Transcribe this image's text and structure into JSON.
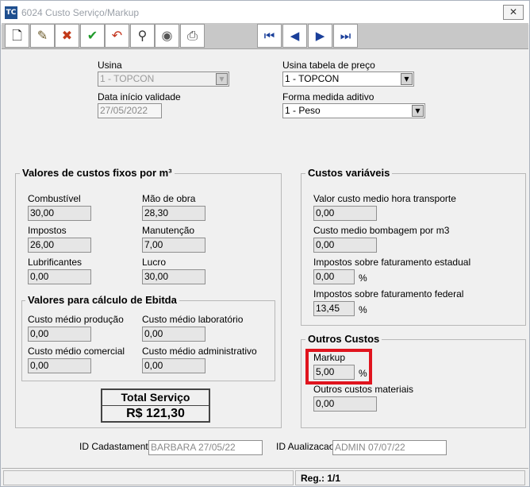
{
  "window": {
    "title": "6024 Custo Serviço/Markup",
    "app_icon": "app-logo-icon",
    "close_glyph": "✕"
  },
  "toolbar": {
    "buttons": [
      {
        "icon": "new-document-icon",
        "glyph": "🗋"
      },
      {
        "icon": "edit-pencil-icon",
        "glyph": "✎"
      },
      {
        "icon": "delete-eraser-icon",
        "glyph": "✖"
      },
      {
        "icon": "confirm-check-icon",
        "glyph": "✔"
      },
      {
        "icon": "undo-arrow-icon",
        "glyph": "↶"
      },
      {
        "icon": "search-binoculars-icon",
        "glyph": "⚲"
      },
      {
        "icon": "filter-bowl-icon",
        "glyph": "◉"
      },
      {
        "icon": "print-icon",
        "glyph": "⎙"
      }
    ],
    "nav": [
      {
        "icon": "first-record-icon",
        "glyph": "⏮"
      },
      {
        "icon": "prev-record-icon",
        "glyph": "◀"
      },
      {
        "icon": "next-record-icon",
        "glyph": "▶"
      },
      {
        "icon": "last-record-icon",
        "glyph": "⏭"
      }
    ]
  },
  "header": {
    "usina_label": "Usina",
    "usina_value": "1 - TOPCON",
    "data_label": "Data início validade",
    "data_value": "27/05/2022",
    "usina_tabela_label": "Usina tabela de preço",
    "usina_tabela_value": "1 - TOPCON",
    "forma_label": "Forma medida aditivo",
    "forma_value": "1 - Peso",
    "dropdown_glyph": "▼"
  },
  "fixos": {
    "title": "Valores de custos fixos por m³",
    "combustivel_label": "Combustível",
    "combustivel_value": "30,00",
    "mao_label": "Mão de obra",
    "mao_value": "28,30",
    "impostos_label": "Impostos",
    "impostos_value": "26,00",
    "manutencao_label": "Manutenção",
    "manutencao_value": "7,00",
    "lubrificantes_label": "Lubrificantes",
    "lubrificantes_value": "0,00",
    "lucro_label": "Lucro",
    "lucro_value": "30,00"
  },
  "ebitda": {
    "title": "Valores para cálculo de Ebitda",
    "producao_label": "Custo médio produção",
    "producao_value": "0,00",
    "laboratorio_label": "Custo médio laboratório",
    "laboratorio_value": "0,00",
    "comercial_label": "Custo médio comercial",
    "comercial_value": "0,00",
    "administrativo_label": "Custo médio administrativo",
    "administrativo_value": "0,00"
  },
  "total": {
    "label": "Total Serviço",
    "value": "R$ 121,30"
  },
  "variaveis": {
    "title": "Custos variáveis",
    "transporte_label": "Valor custo medio hora transporte",
    "transporte_value": "0,00",
    "bombagem_label": "Custo medio bombagem por m3",
    "bombagem_value": "0,00",
    "estadual_label": "Impostos sobre faturamento estadual",
    "estadual_value": "0,00",
    "federal_label": "Impostos sobre faturamento federal",
    "federal_value": "13,45",
    "percent": "%"
  },
  "outros": {
    "title": "Outros Custos",
    "markup_label": "Markup",
    "markup_value": "5,00",
    "materiais_label": "Outros custos materiais",
    "materiais_value": "0,00",
    "percent": "%",
    "highlight_color": "#e0141e"
  },
  "footer": {
    "cadastro_label": "ID Cadastamento",
    "cadastro_value": "BARBARA 27/05/22",
    "atualizacao_label": "ID Aualizacao",
    "atualizacao_value": "ADMIN 07/07/22"
  },
  "status": {
    "reg": "Reg.: 1/1"
  }
}
